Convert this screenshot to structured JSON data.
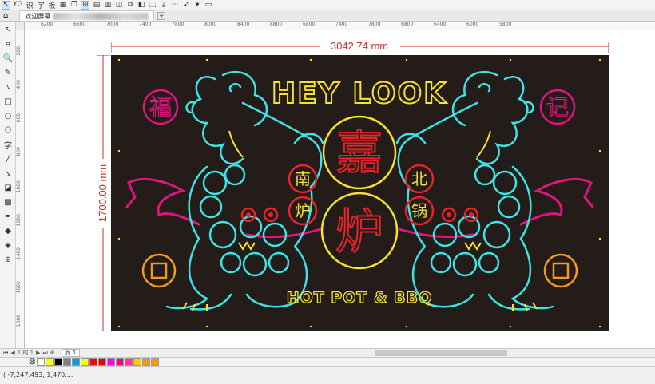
{
  "toolbar": {
    "items": [
      {
        "name": "pick-tool",
        "glyph": "↖",
        "selected": true
      },
      {
        "name": "node-tool",
        "glyph": "YG"
      },
      {
        "name": "text-char-1",
        "glyph": "识"
      },
      {
        "name": "text-char-2",
        "glyph": "字"
      },
      {
        "name": "text-char-3",
        "glyph": "板"
      },
      {
        "name": "grid-icon",
        "glyph": "▦"
      },
      {
        "name": "copy-icon",
        "glyph": "❐"
      },
      {
        "name": "snap-icon",
        "glyph": "⊞",
        "selected": true
      },
      {
        "name": "align-icon",
        "glyph": "▤"
      },
      {
        "name": "arrange-icon",
        "glyph": "▥"
      },
      {
        "name": "group-icon",
        "glyph": "◫"
      },
      {
        "name": "weld-icon",
        "glyph": "⧉"
      },
      {
        "name": "trim-icon",
        "glyph": "◧"
      },
      {
        "name": "frame-icon",
        "glyph": "⬚"
      },
      {
        "name": "export-icon",
        "glyph": "⤓"
      },
      {
        "name": "dots-icon",
        "glyph": "⋯"
      },
      {
        "name": "arrow-icon",
        "glyph": "➹"
      },
      {
        "name": "leaf-icon",
        "glyph": "❦"
      },
      {
        "name": "ruler-icon",
        "glyph": "▭"
      }
    ]
  },
  "tabs": {
    "home_icon": "⌂",
    "doc_label": "欢迎屏幕",
    "add": "+"
  },
  "tools": [
    {
      "name": "pick-tool-icon",
      "glyph": "↖"
    },
    {
      "name": "crop-tool-icon",
      "glyph": "⌗"
    },
    {
      "name": "zoom-tool-icon",
      "glyph": "🔍"
    },
    {
      "name": "freehand-tool-icon",
      "glyph": "✎"
    },
    {
      "name": "curve-tool-icon",
      "glyph": "∿"
    },
    {
      "name": "rectangle-tool-icon",
      "glyph": "□"
    },
    {
      "name": "ellipse-tool-icon",
      "glyph": "○"
    },
    {
      "name": "polygon-tool-icon",
      "glyph": "⬠"
    },
    {
      "name": "text-tool-icon",
      "glyph": "字"
    },
    {
      "name": "line-tool-icon",
      "glyph": "╱"
    },
    {
      "name": "connector-tool-icon",
      "glyph": "↘"
    },
    {
      "name": "shadow-tool-icon",
      "glyph": "◪"
    },
    {
      "name": "transparency-tool-icon",
      "glyph": "▩"
    },
    {
      "name": "eyedropper-tool-icon",
      "glyph": "✒"
    },
    {
      "name": "fill-tool-icon",
      "glyph": "◆"
    },
    {
      "name": "smart-fill-tool-icon",
      "glyph": "◈"
    },
    {
      "name": "add-tool-icon",
      "glyph": "⊕"
    }
  ],
  "ruler": {
    "h_ticks": [
      "6200",
      "6600",
      "7000",
      "7400",
      "7800",
      "8000",
      "8400",
      "8800",
      "6800",
      "7400",
      "7800",
      "6800",
      "6400",
      "6000",
      "5800"
    ],
    "v_ticks": [
      "200",
      "400",
      "600",
      "800",
      "1000",
      "1200",
      "1400",
      "1600",
      "1800"
    ]
  },
  "dimensions": {
    "width_label": "3042.74 mm",
    "height_label": "1700.00 mm"
  },
  "artwork": {
    "title": "HEY LOOK",
    "subtitle": "HOT POT & BBQ",
    "left_seal": "福",
    "right_seal": "记",
    "center_top": "嘉",
    "center_bottom": "炉",
    "left_top": "南",
    "left_bottom": "炉",
    "right_top": "北",
    "right_bottom": "锅",
    "colors": {
      "background": "#241c18",
      "cyan": "#3de3e6",
      "yellow": "#f7e32b",
      "red": "#e8232c",
      "magenta": "#e0147f",
      "orange": "#f29a1c"
    }
  },
  "pages": {
    "nav_first": "⏮",
    "nav_prev": "◀",
    "page_count": "1 的 1",
    "nav_next": "▶",
    "nav_last": "⏭",
    "add_page": "⊕",
    "page_tab": "页 1"
  },
  "palette": {
    "none": "⊠",
    "swatches": [
      "#ffffff",
      "#ffff00",
      "#000000",
      "#808080",
      "#00a0e9",
      "#ffff00",
      "#ff0000",
      "#e60012",
      "#ff00ff",
      "#ff0080",
      "#ff3399",
      "#ffcc00",
      "#f29a1c",
      "#ff9900"
    ]
  },
  "status": {
    "coords": "( -7,247.493, 1,470...."
  }
}
